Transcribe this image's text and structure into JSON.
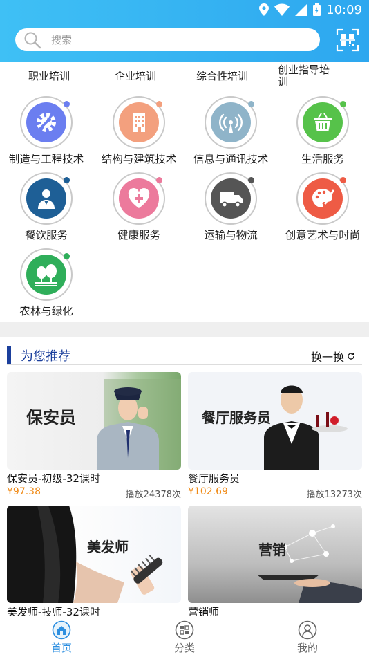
{
  "status": {
    "time": "10:09"
  },
  "search": {
    "placeholder": "搜索"
  },
  "categories": [
    "职业培训",
    "企业培训",
    "综合性培训",
    "创业指导培训"
  ],
  "grid": [
    {
      "label": "制造与工程技术",
      "icon": "gear-wrench-icon",
      "color": "#6b7ef0",
      "dot": "#6b7ef0"
    },
    {
      "label": "结构与建筑技术",
      "icon": "building-icon",
      "color": "#f3a07e",
      "dot": "#f3a07e"
    },
    {
      "label": "信息与通讯技术",
      "icon": "antenna-icon",
      "color": "#8fb4c9",
      "dot": "#8fb4c9"
    },
    {
      "label": "生活服务",
      "icon": "basket-icon",
      "color": "#56c24a",
      "dot": "#56c24a"
    },
    {
      "label": "餐饮服务",
      "icon": "chef-icon",
      "color": "#1e5f96",
      "dot": "#1e5f96"
    },
    {
      "label": "健康服务",
      "icon": "heart-plus-icon",
      "color": "#ec7a9c",
      "dot": "#ec7a9c"
    },
    {
      "label": "运输与物流",
      "icon": "truck-icon",
      "color": "#555555",
      "dot": "#555555"
    },
    {
      "label": "创意艺术与时尚",
      "icon": "palette-icon",
      "color": "#ee5b45",
      "dot": "#ee5b45"
    },
    {
      "label": "农林与绿化",
      "icon": "trees-icon",
      "color": "#2fae5a",
      "dot": "#2fae5a"
    }
  ],
  "recommend": {
    "title": "为您推荐",
    "swap": "换一换"
  },
  "courses": [
    {
      "pic_label": "保安员",
      "name": "保安员-初级-32课时",
      "price": "¥97.38",
      "plays": "播放24378次"
    },
    {
      "pic_label": "餐厅服务员",
      "name": "餐厅服务员",
      "price": "¥102.69",
      "plays": "播放13273次"
    },
    {
      "pic_label": "美发师",
      "name": "美发师-技师-32课时",
      "price": "",
      "plays": ""
    },
    {
      "pic_label": "营销",
      "name": "营销师",
      "price": "",
      "plays": ""
    }
  ],
  "tabs": [
    {
      "label": "首页",
      "active": true
    },
    {
      "label": "分类",
      "active": false
    },
    {
      "label": "我的",
      "active": false
    }
  ],
  "colors": {
    "accent": "#2da7ef",
    "price": "#f08a16",
    "recommend": "#1b3f9c"
  }
}
